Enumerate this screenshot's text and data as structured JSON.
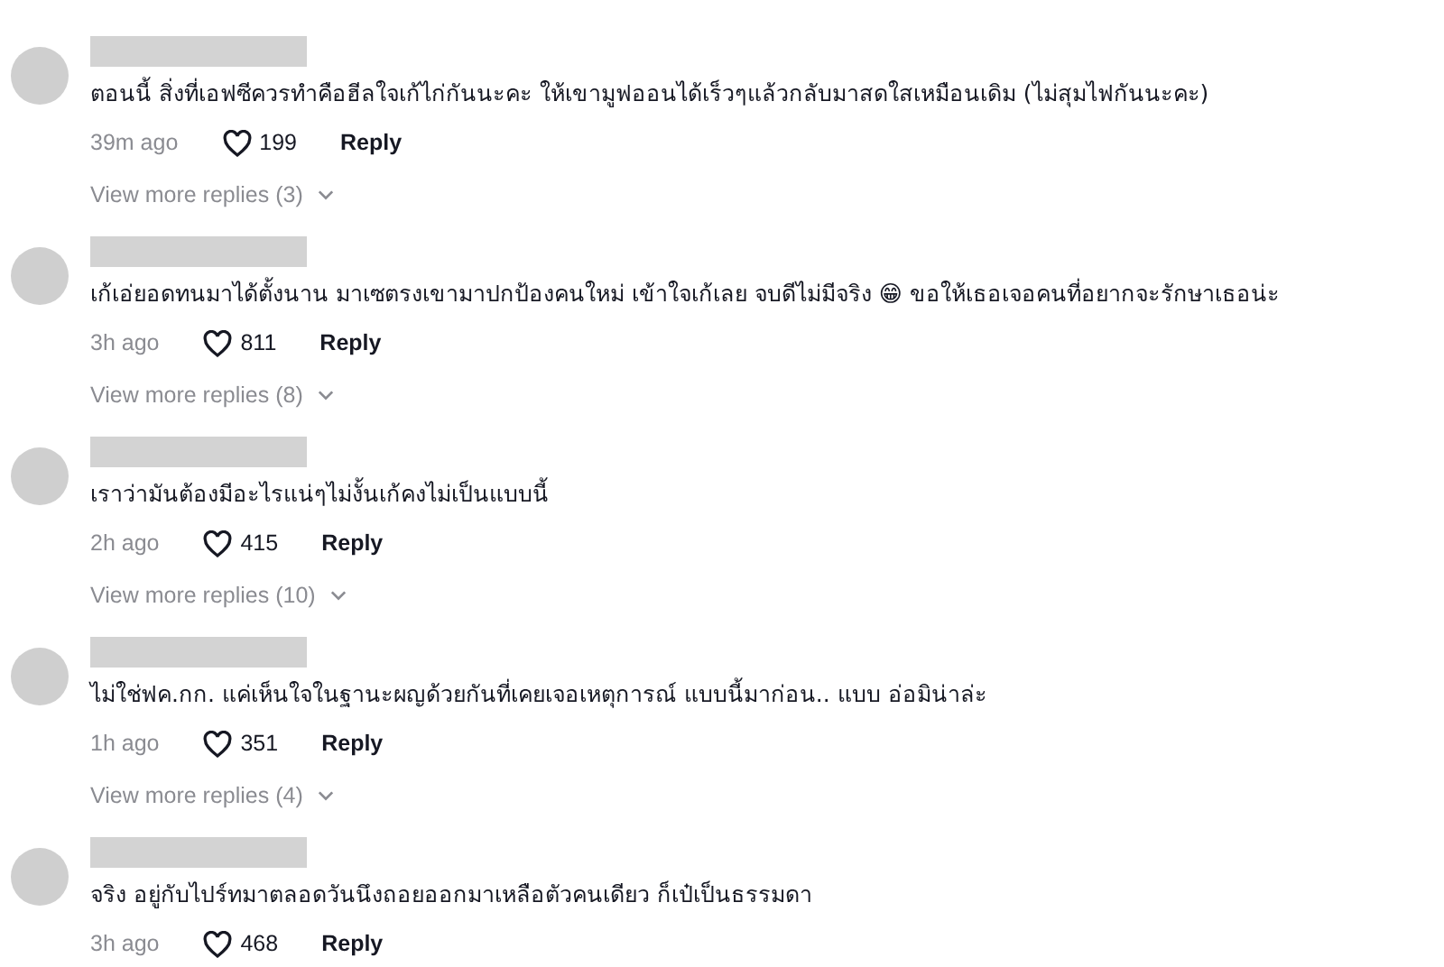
{
  "comments": [
    {
      "name_hidden": true,
      "text": "ตอนนี้ สิ่งที่เอฟซีควรทำคือฮีลใจเก้ไก่กันนะคะ ให้เขามูฟออนได้เร็วๆแล้วกลับมาสดใสเหมือนเดิม (ไม่สุมไฟกันนะคะ)",
      "time": "39m ago",
      "likes": "199",
      "reply": "Reply",
      "more_replies": "View more replies (3)"
    },
    {
      "name_hidden": true,
      "text": "เก้เอ่ยอดทนมาได้ตั้งนาน มาเซตรงเขามาปกป้องคนใหม่ เข้าใจเก้เลย จบดีไม่มีจริง 😁  ขอให้เธอเจอคนที่อยากจะรักษาเธอน่ะ",
      "time": "3h ago",
      "likes": "811",
      "reply": "Reply",
      "more_replies": "View more replies (8)"
    },
    {
      "name_hidden": true,
      "text": "เราว่ามันต้องมีอะไรแน่ๆไม่งั้นเก้คงไม่เป็นแบบนี้",
      "time": "2h ago",
      "likes": "415",
      "reply": "Reply",
      "more_replies": "View more replies (10)"
    },
    {
      "name_hidden": true,
      "text": "ไม่ใช่ฟค.กก. แค่เห็นใจในฐานะผญด้วยกันที่เคยเจอเหตุการณ์ แบบนี้มาก่อน.. แบบ อ่อมิน่าล่ะ",
      "time": "1h ago",
      "likes": "351",
      "reply": "Reply",
      "more_replies": "View more replies (4)"
    },
    {
      "name_hidden": true,
      "text": "จริง อยู่กับไปร์ทมาตลอดวันนึงถอยออกมาเหลือตัวคนเดียว ก็เป๋เป็นธรรมดา",
      "time": "3h ago",
      "likes": "468",
      "reply": "Reply"
    }
  ]
}
